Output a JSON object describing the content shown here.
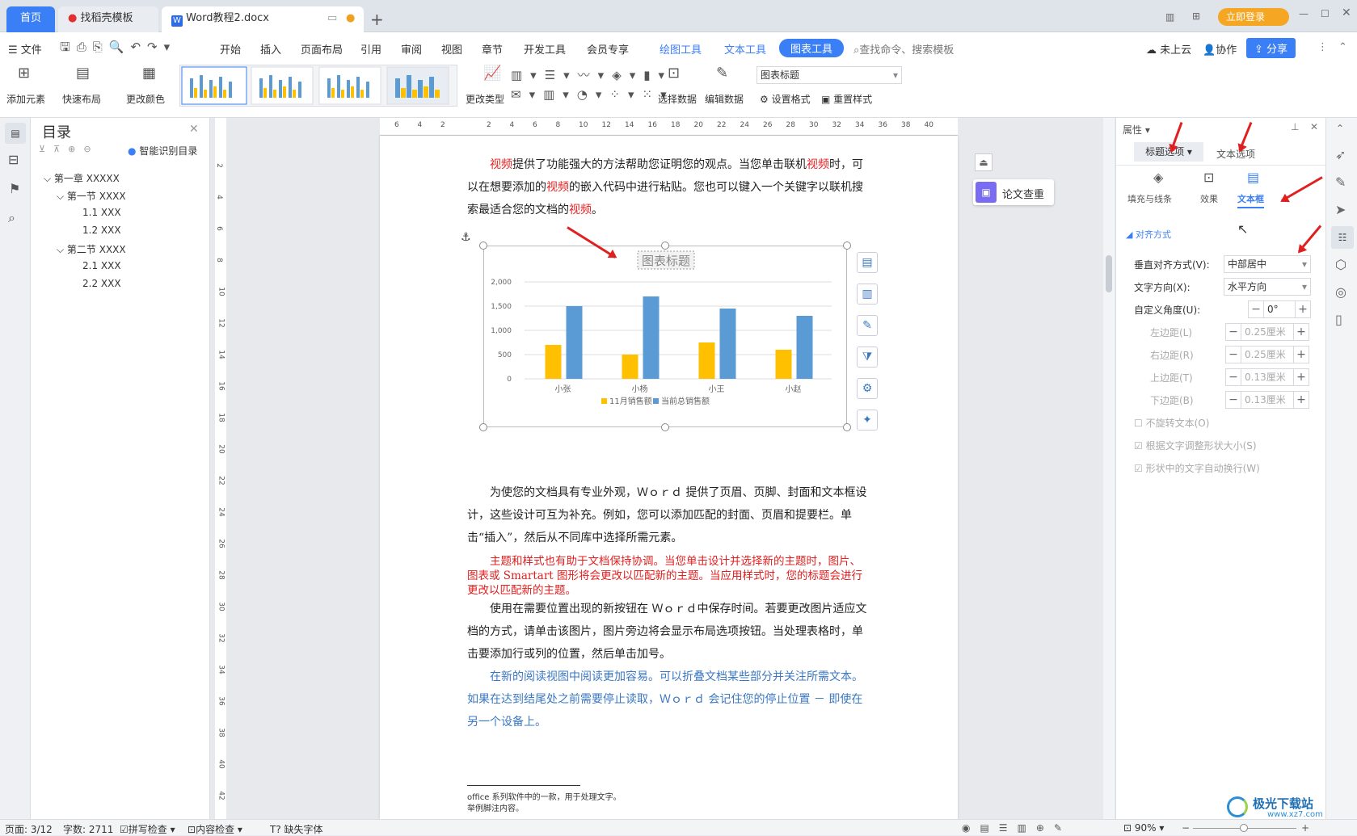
{
  "tabs": {
    "home": "首页",
    "template": "找稻壳模板",
    "doc": "Word教程2.docx",
    "login": "立即登录"
  },
  "menu": {
    "file": "文件",
    "items": [
      "开始",
      "插入",
      "页面布局",
      "引用",
      "审阅",
      "视图",
      "章节",
      "开发工具",
      "会员专享",
      "绘图工具",
      "文本工具",
      "图表工具"
    ],
    "search": "查找命令、搜索模板",
    "cloud": "未上云",
    "collab": "协作",
    "share": "分享"
  },
  "ribbon": {
    "add_element": "添加元素",
    "quick_layout": "快速布局",
    "change_color": "更改颜色",
    "change_type": "更改类型",
    "select_data": "选择数据",
    "edit_data": "编辑数据",
    "element_select": "图表标题",
    "set_format": "设置格式",
    "reset_style": "重置样式"
  },
  "toc": {
    "title": "目录",
    "smart": "智能识别目录",
    "items": [
      "第一章 XXXXX",
      "第一节 XXXX",
      "1.1 XXX",
      "1.2 XXX",
      "第二节 XXXX",
      "2.1 XXX",
      "2.2 XXX"
    ]
  },
  "ruler": [
    "6",
    "4",
    "2",
    "",
    "2",
    "4",
    "6",
    "8",
    "10",
    "12",
    "14",
    "16",
    "18",
    "20",
    "22",
    "24",
    "26",
    "28",
    "30",
    "32",
    "34",
    "36",
    "38",
    "40"
  ],
  "vruler": [
    "2",
    "4",
    "6",
    "8",
    "10",
    "12",
    "14",
    "16",
    "18",
    "20",
    "22",
    "24",
    "26",
    "28",
    "30",
    "32",
    "34",
    "36",
    "38",
    "40",
    "42"
  ],
  "doc": {
    "p1a": "视频",
    "p1b": "提供了功能强大的方法帮助您证明您的观点。当您单击联机",
    "p1c": "视频",
    "p1d": "时，",
    "p1e": "可以在想要添加的",
    "p1f": "视频",
    "p1g": "的嵌入代码中进行粘贴。您也可以键入一个关键字以联",
    "p1h": "机搜索最适合您的文档的",
    "p1i": "视频",
    "p1j": "。",
    "p2": "为使您的文档具有专业外观，Ｗｏｒｄ 提供了页眉、页脚、封面和文本框设计，这些设计可互为补充。例如，您可以添加匹配的封面、页眉和提要栏。单击“插入”，然后从不同库中选择所需元素。",
    "p3": "主题和样式也有助于文档保持协调。当您单击设计并选择新的主题时，图片、图表或 Smartart 图形将会更改以匹配新的主题。当应用样式时，您的标题会进行更改以匹配新的主题。",
    "p4": "使用在需要位置出现的新按钮在 Ｗｏｒｄ中保存时间。若要更改图片适应文档的方式，请单击该图片，图片旁边将会显示布局选项按钮。当处理表格时，单击要添加行或列的位置，然后单击加号。",
    "p5": "在新的阅读视图中阅读更加容易。可以折叠文档某些部分并关注所需文本。如果在达到结尾处之前需要停止读取，Ｗｏｒｄ 会记住您的停止位置 － 即使在另一个设备上。",
    "fn1": "office 系列软件中的一款，用于处理文字。",
    "fn2": "举例脚注内容。",
    "paper_check": "论文查重"
  },
  "chart_data": {
    "type": "bar",
    "title": "图表标题",
    "categories": [
      "小张",
      "小杨",
      "小王",
      "小赵"
    ],
    "series": [
      {
        "name": "11月销售额",
        "values": [
          700,
          500,
          750,
          600
        ],
        "color": "#ffc000"
      },
      {
        "name": "当前总销售额",
        "values": [
          1500,
          1700,
          1450,
          1300
        ],
        "color": "#5b9bd5"
      }
    ],
    "yticks": [
      "2,000",
      "1,500",
      "1,000",
      "500",
      "0"
    ],
    "ylim": [
      0,
      2000
    ]
  },
  "props": {
    "header": "属性",
    "tab1": "标题选项",
    "tab2": "文本选项",
    "sub1": "填充与线条",
    "sub2": "效果",
    "sub3": "文本框",
    "section": "对齐方式",
    "valign_label": "垂直对齐方式(V):",
    "valign": "中部居中",
    "tdir_label": "文字方向(X):",
    "tdir": "水平方向",
    "angle_label": "自定义角度(U):",
    "angle": "0°",
    "left_label": "左边距(L)",
    "left": "0.25厘米",
    "right_label": "右边距(R)",
    "right": "0.25厘米",
    "top_label": "上边距(T)",
    "top": "0.13厘米",
    "bottom_label": "下边距(B)",
    "bottom": "0.13厘米",
    "cb1": "不旋转文本(O)",
    "cb2": "根据文字调整形状大小(S)",
    "cb3": "形状中的文字自动换行(W)"
  },
  "status": {
    "page": "页面: 3/12",
    "words": "字数: 2711",
    "spell": "拼写检查",
    "content": "内容检查",
    "font": "缺失字体",
    "zoom": "90%"
  },
  "watermark": "极光下载站",
  "watermark_url": "www.xz7.com"
}
